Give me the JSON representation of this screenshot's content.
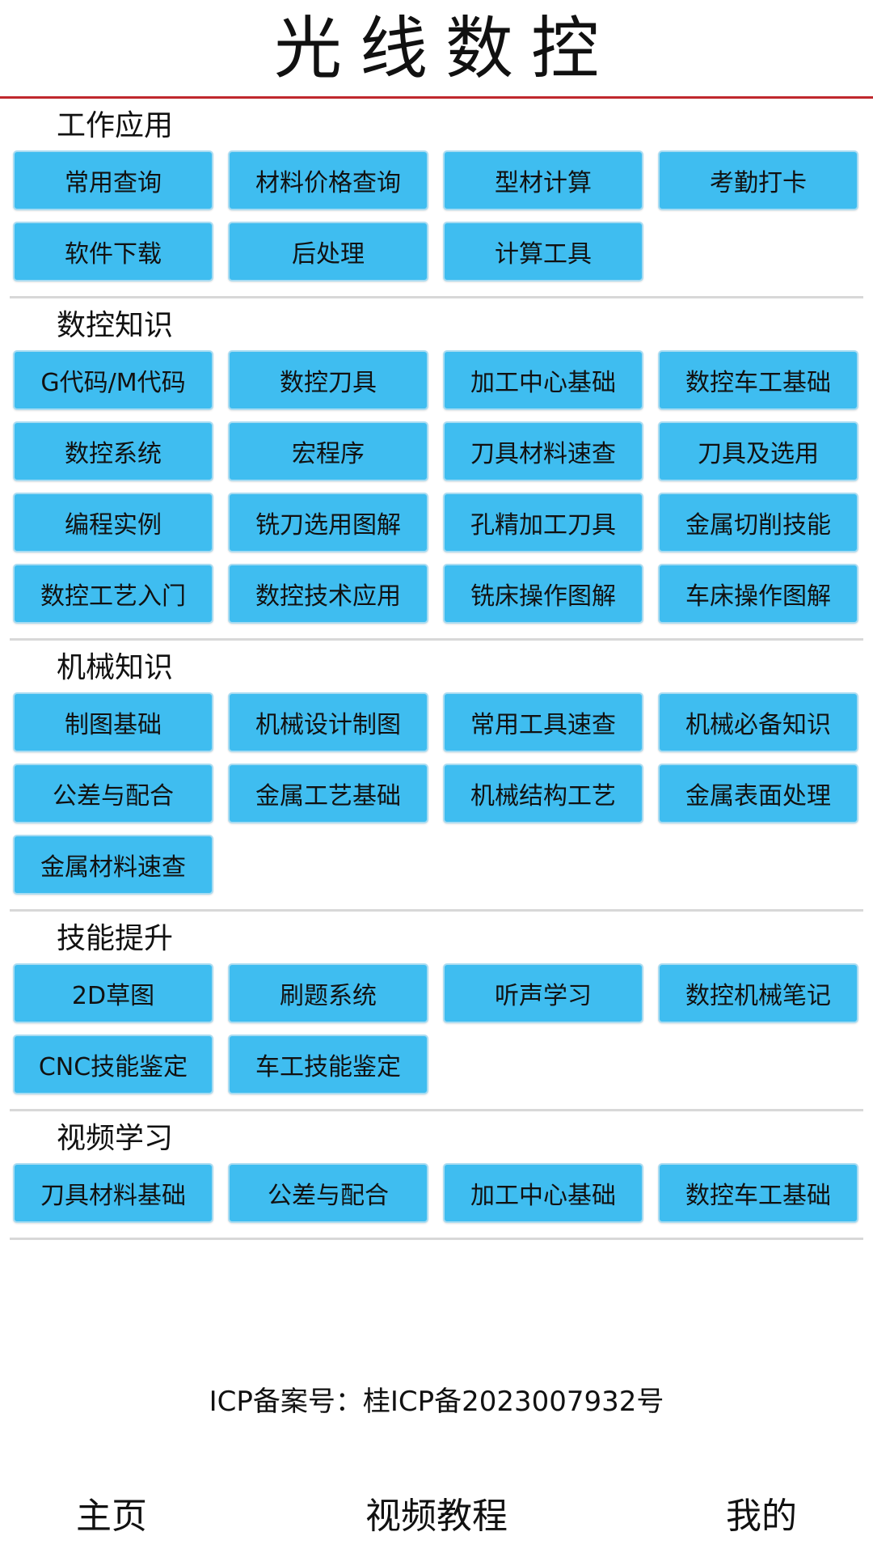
{
  "header": {
    "title": "光线数控"
  },
  "sections": [
    {
      "title": "工作应用",
      "items": [
        "常用查询",
        "材料价格查询",
        "型材计算",
        "考勤打卡",
        "软件下载",
        "后处理",
        "计算工具"
      ]
    },
    {
      "title": "数控知识",
      "items": [
        "G代码/M代码",
        "数控刀具",
        "加工中心基础",
        "数控车工基础",
        "数控系统",
        "宏程序",
        "刀具材料速查",
        "刀具及选用",
        "编程实例",
        "铣刀选用图解",
        "孔精加工刀具",
        "金属切削技能",
        "数控工艺入门",
        "数控技术应用",
        "铣床操作图解",
        "车床操作图解"
      ]
    },
    {
      "title": "机械知识",
      "items": [
        "制图基础",
        "机械设计制图",
        "常用工具速查",
        "机械必备知识",
        "公差与配合",
        "金属工艺基础",
        "机械结构工艺",
        "金属表面处理",
        "金属材料速查"
      ]
    },
    {
      "title": "技能提升",
      "items": [
        "2D草图",
        "刷题系统",
        "听声学习",
        "数控机械笔记",
        "CNC技能鉴定",
        "车工技能鉴定"
      ]
    },
    {
      "title": "视频学习",
      "items": [
        "刀具材料基础",
        "公差与配合",
        "加工中心基础",
        "数控车工基础"
      ]
    }
  ],
  "footer": {
    "icp": "ICP备案号：桂ICP备2023007932号"
  },
  "tabbar": {
    "home": "主页",
    "videos": "视频教程",
    "mine": "我的"
  },
  "colors": {
    "button_bg": "#3fbdf0",
    "header_rule": "#c0282d"
  }
}
